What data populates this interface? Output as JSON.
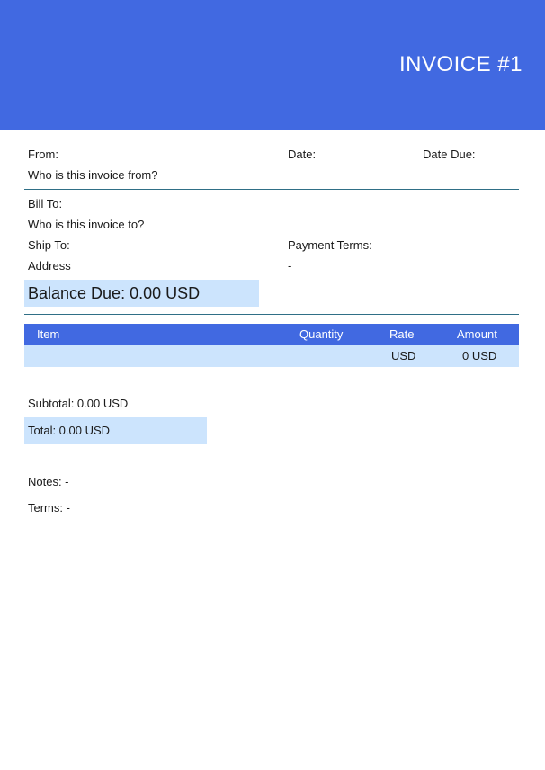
{
  "header": {
    "title": "INVOICE #1"
  },
  "from": {
    "label": "From:",
    "value": "Who is this invoice from?"
  },
  "date": {
    "label": "Date:"
  },
  "date_due": {
    "label": "Date Due:"
  },
  "bill_to": {
    "label": "Bill To:",
    "value": "Who is this invoice to?"
  },
  "ship_to": {
    "label": "Ship To:",
    "value": "Address"
  },
  "payment_terms": {
    "label": "Payment Terms:",
    "value": "-"
  },
  "balance_due": "Balance Due: 0.00 USD",
  "table": {
    "headers": [
      "Item",
      "Quantity",
      "Rate",
      "Amount"
    ],
    "rows": [
      {
        "item": "",
        "quantity": "",
        "rate": "USD",
        "amount": "0 USD"
      }
    ]
  },
  "subtotal": "Subtotal: 0.00 USD",
  "total": "Total: 0.00 USD",
  "notes": "Notes: -",
  "terms": "Terms: -",
  "colors": {
    "header_bg": "#4169e1",
    "highlight_bg": "#cce4fd",
    "rule": "#2f6f86"
  }
}
